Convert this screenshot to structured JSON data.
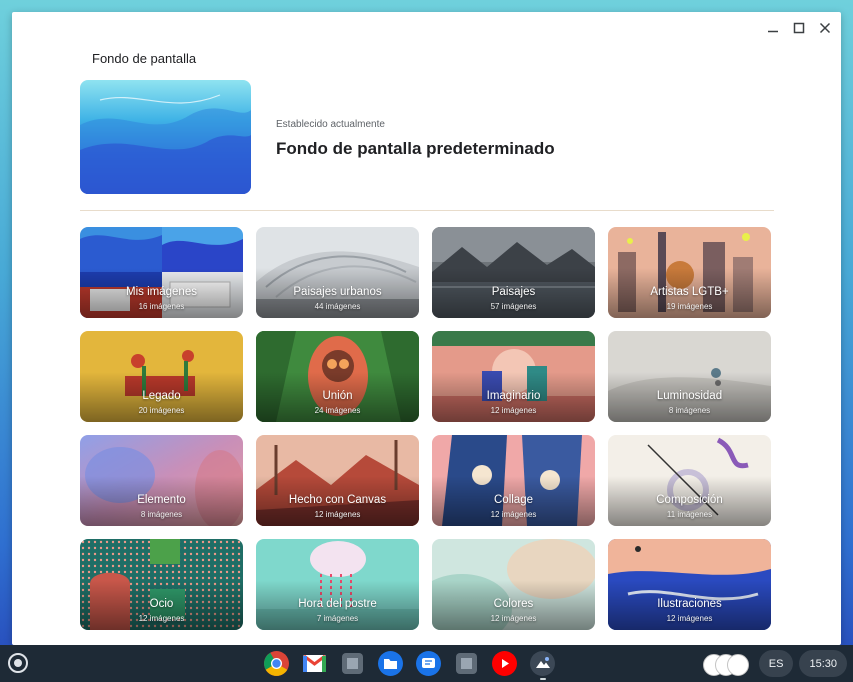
{
  "window": {
    "title": "Fondo de pantalla",
    "controls": [
      "minimize-icon",
      "maximize-icon",
      "close-icon"
    ]
  },
  "current": {
    "subtitle": "Establecido actualmente",
    "name": "Fondo de pantalla predeterminado"
  },
  "collections": [
    {
      "label": "Mis imágenes",
      "count": "16 imágenes"
    },
    {
      "label": "Paisajes urbanos",
      "count": "44 imágenes"
    },
    {
      "label": "Paisajes",
      "count": "57 imágenes"
    },
    {
      "label": "Artistas LGTB+",
      "count": "19 imágenes"
    },
    {
      "label": "Legado",
      "count": "20 imágenes"
    },
    {
      "label": "Unión",
      "count": "24 imágenes"
    },
    {
      "label": "Imaginario",
      "count": "12 imágenes"
    },
    {
      "label": "Luminosidad",
      "count": "8 imágenes"
    },
    {
      "label": "Elemento",
      "count": "8 imágenes"
    },
    {
      "label": "Hecho con Canvas",
      "count": "12 imágenes"
    },
    {
      "label": "Collage",
      "count": "12 imágenes"
    },
    {
      "label": "Composición",
      "count": "11 imágenes"
    },
    {
      "label": "Ocio",
      "count": "12 imágenes"
    },
    {
      "label": "Hora del postre",
      "count": "7 imágenes"
    },
    {
      "label": "Colores",
      "count": "12 imágenes"
    },
    {
      "label": "Ilustraciones",
      "count": "12 imágenes"
    }
  ],
  "shelf": {
    "apps": [
      "chrome-icon",
      "gmail-icon",
      "app-icon",
      "files-icon",
      "messages-icon",
      "app-icon",
      "youtube-icon",
      "wallpaper-app-icon"
    ],
    "ime": "ES",
    "time": "15:30"
  }
}
